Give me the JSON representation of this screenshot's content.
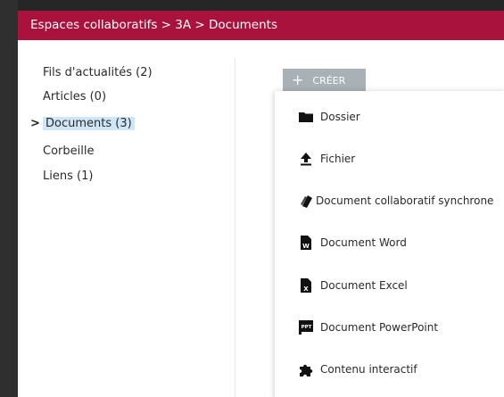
{
  "breadcrumb": "Espaces collaboratifs > 3A > Documents",
  "sidebar": {
    "items": [
      {
        "label": "Fils d'actualités (2)"
      },
      {
        "label": "Articles (0)"
      },
      {
        "label": "Documents (3)"
      },
      {
        "label": "Corbeille"
      },
      {
        "label": "Liens (1)"
      }
    ],
    "active_marker": ">"
  },
  "create_button": {
    "icon": "+",
    "label": "CRÉER"
  },
  "create_menu": {
    "items": [
      {
        "label": "Dossier",
        "icon": "folder-icon"
      },
      {
        "label": "Fichier",
        "icon": "upload-icon"
      },
      {
        "label": "Document collaboratif synchrone",
        "icon": "collaborative-doc-icon"
      },
      {
        "label": "Document Word",
        "icon": "word-icon",
        "badge": "W"
      },
      {
        "label": "Document Excel",
        "icon": "excel-icon",
        "badge": "X"
      },
      {
        "label": "Document PowerPoint",
        "icon": "powerpoint-icon",
        "badge": "PPT"
      },
      {
        "label": "Contenu interactif",
        "icon": "puzzle-icon"
      }
    ]
  },
  "colors": {
    "header": "#a8123d",
    "active_highlight": "#cfe6f7",
    "create_button": "#a8b1b6"
  }
}
